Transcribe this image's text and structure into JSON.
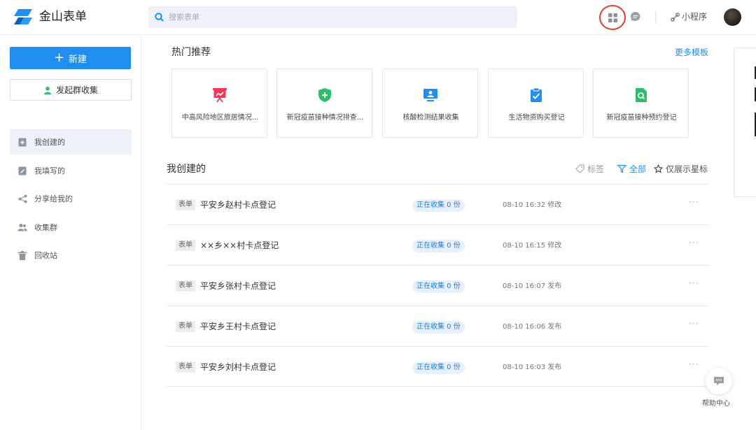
{
  "app": {
    "name": "金山表单"
  },
  "search": {
    "placeholder": "搜索表单"
  },
  "header": {
    "mini_program": "小程序"
  },
  "sidebar": {
    "new_button": "新建",
    "group_collect": "发起群收集",
    "items": [
      {
        "label": "我创建的",
        "icon": "doc-plus-icon",
        "active": true
      },
      {
        "label": "我填写的",
        "icon": "doc-edit-icon",
        "active": false
      },
      {
        "label": "分享给我的",
        "icon": "share-icon",
        "active": false
      },
      {
        "label": "收集群",
        "icon": "group-icon",
        "active": false
      },
      {
        "label": "回收站",
        "icon": "trash-icon",
        "active": false
      }
    ]
  },
  "hot": {
    "title": "热门推荐",
    "more": "更多模板",
    "templates": [
      {
        "label": "中高风险地区旅居情况...",
        "icon": "presentation-icon",
        "color": "#ef3b55"
      },
      {
        "label": "新冠疫苗接种情况排查...",
        "icon": "shield-plus-icon",
        "color": "#2ebd6b"
      },
      {
        "label": "核酸检测结果收集",
        "icon": "monitor-user-icon",
        "color": "#1f8ef0"
      },
      {
        "label": "生活物资购买登记",
        "icon": "clipboard-check-icon",
        "color": "#1f8ef0"
      },
      {
        "label": "新冠疫苗接种预约登记",
        "icon": "doc-search-icon",
        "color": "#2ebd6b"
      }
    ]
  },
  "mine": {
    "title": "我创建的",
    "filter_tag": "标签",
    "filter_all": "全部",
    "filter_starred": "仅展示星标",
    "rows": [
      {
        "tag": "表单",
        "name": "平安乡赵村卡点登记",
        "status": "正在收集 0 份",
        "time": "08-10 16:32 修改"
      },
      {
        "tag": "表单",
        "name": "××乡××村卡点登记",
        "status": "正在收集 0 份",
        "time": "08-10 16:15 修改"
      },
      {
        "tag": "表单",
        "name": "平安乡张村卡点登记",
        "status": "正在收集 0 份",
        "time": "08-10 16:07 发布"
      },
      {
        "tag": "表单",
        "name": "平安乡王村卡点登记",
        "status": "正在收集 0 份",
        "time": "08-10 16:06 发布"
      },
      {
        "tag": "表单",
        "name": "平安乡刘村卡点登记",
        "status": "正在收集 0 份",
        "time": "08-10 16:03 发布"
      }
    ]
  },
  "help": {
    "label": "帮助中心"
  },
  "colors": {
    "accent": "#1f8ef0",
    "highlight_ring": "#e43a2f"
  }
}
